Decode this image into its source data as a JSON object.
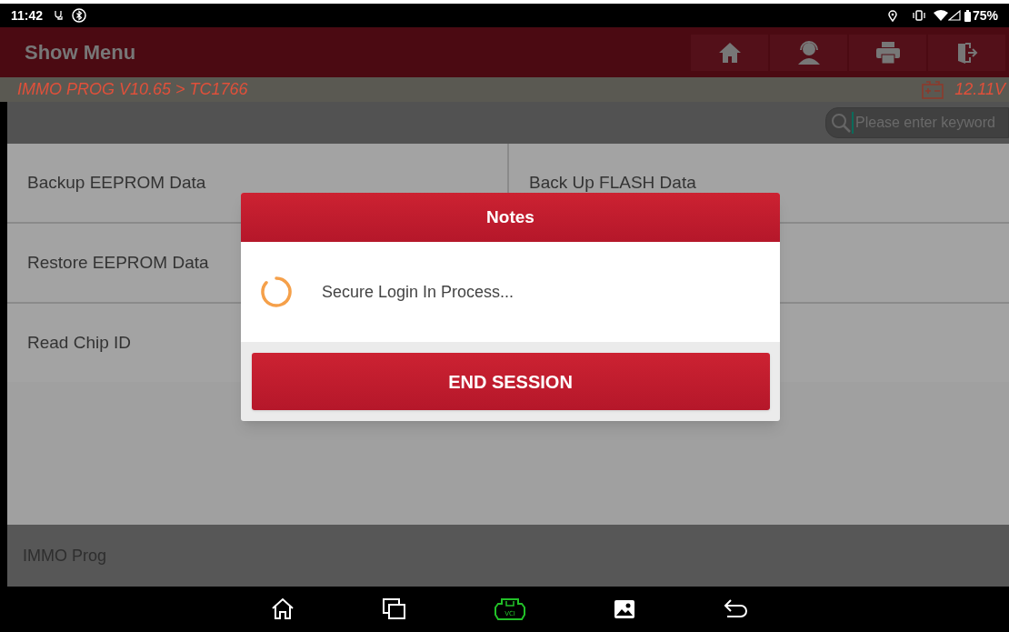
{
  "status_bar": {
    "time": "11:42",
    "battery": "75%"
  },
  "header": {
    "title": "Show Menu"
  },
  "breadcrumb": {
    "path": "IMMO PROG V10.65 > TC1766",
    "voltage": "12.11V"
  },
  "search": {
    "placeholder": "Please enter keyword"
  },
  "menu_left": [
    {
      "label": "Backup EEPROM Data"
    },
    {
      "label": "Restore EEPROM Data"
    },
    {
      "label": "Read Chip ID"
    }
  ],
  "menu_right": [
    {
      "label": "Back Up FLASH Data"
    }
  ],
  "nav_bar": {
    "vci_label": "VCI"
  },
  "footer": {
    "label": "IMMO Prog"
  },
  "dialog": {
    "title": "Notes",
    "message": "Secure Login In Process...",
    "button": "END SESSION"
  }
}
